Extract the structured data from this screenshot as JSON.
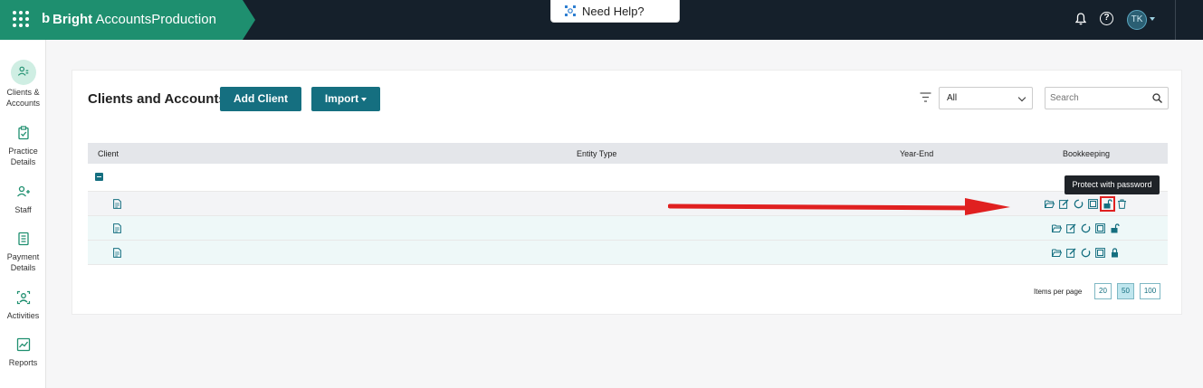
{
  "app": {
    "brand_logo": "b",
    "brand_bold": "Bright",
    "brand_rest": " AccountsProduction",
    "help_label": "Need Help?",
    "avatar_initials": "TK"
  },
  "sidebar": {
    "items": [
      {
        "label_line1": "Clients &",
        "label_line2": "Accounts",
        "icon": "clients-icon",
        "active": true
      },
      {
        "label_line1": "Practice",
        "label_line2": "Details",
        "icon": "clipboard-check-icon"
      },
      {
        "label_line1": "Staff",
        "label_line2": "",
        "icon": "staff-icon"
      },
      {
        "label_line1": "Payment",
        "label_line2": "Details",
        "icon": "receipt-icon"
      },
      {
        "label_line1": "Activities",
        "label_line2": "",
        "icon": "activities-icon"
      },
      {
        "label_line1": "Reports",
        "label_line2": "",
        "icon": "chart-icon"
      }
    ]
  },
  "main": {
    "title": "Clients and Accounts",
    "add_client_label": "Add Client",
    "import_label": "Import",
    "filter_value": "All",
    "search_placeholder": "Search"
  },
  "table": {
    "columns": [
      "Client",
      "Entity Type",
      "Year-End",
      "Bookkeeping"
    ],
    "rows": [
      {
        "client": "",
        "entity_type": "",
        "year_end": "",
        "lock": "unlocked"
      },
      {
        "client": "",
        "entity_type": "",
        "year_end": "",
        "lock": "unlocked"
      },
      {
        "client": "",
        "entity_type": "",
        "year_end": "",
        "lock": "locked"
      }
    ]
  },
  "tooltip": "Protect with password",
  "pagination": {
    "label": "Items per page",
    "options": [
      "20",
      "50",
      "100"
    ],
    "selected": "50"
  },
  "colors": {
    "brand_green": "#1e8f6f",
    "topbar": "#15202b",
    "primary_button": "#156f80",
    "annotation_red": "#e02020"
  }
}
